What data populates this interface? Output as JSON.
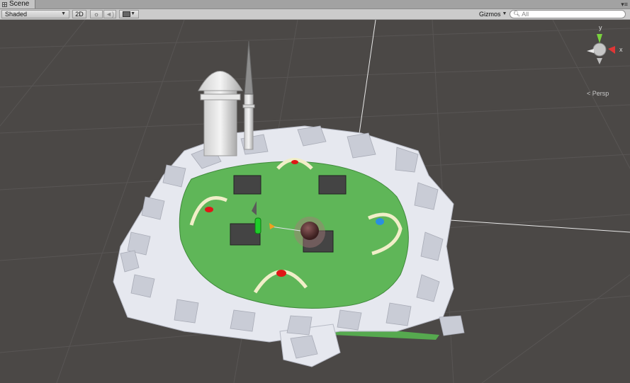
{
  "window": {
    "tab_title": "Scene"
  },
  "toolbar": {
    "draw_mode": "Shaded",
    "mode_2d": "2D",
    "lighting_icon": "sun-icon",
    "audio_icon": "speaker-icon",
    "effects_icon": "image-icon",
    "gizmos_label": "Gizmos",
    "search_placeholder": "All",
    "search_icon": "magnifier-icon"
  },
  "scene_gizmo": {
    "y_label": "y",
    "x_label": "x",
    "projection": "Persp"
  },
  "colors": {
    "grass": "#5fb658",
    "rocks": "#e6e8ef",
    "viewport_bg": "#4b4846",
    "red_marker": "#e01616",
    "blue_marker": "#2a8fe0"
  }
}
